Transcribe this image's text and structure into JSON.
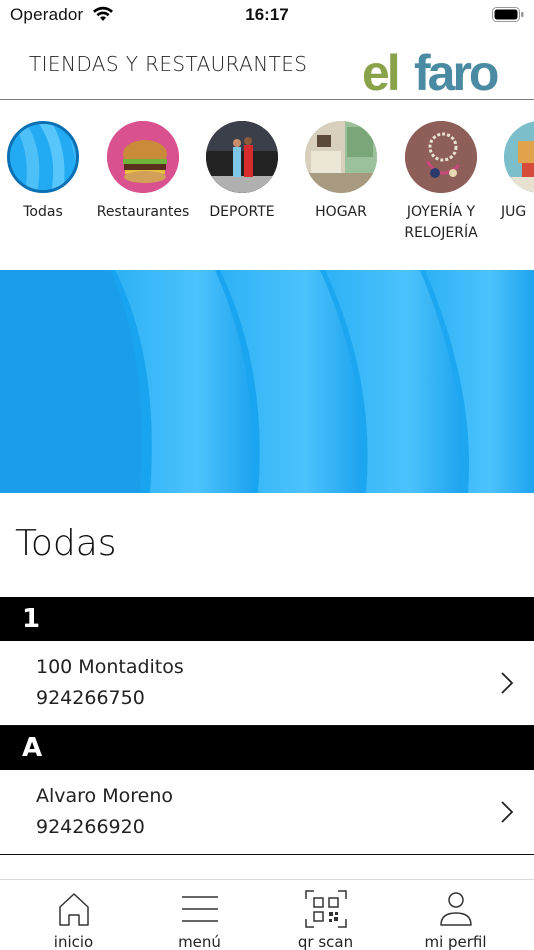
{
  "status_bar": {
    "carrier": "Operador",
    "time": "16:17"
  },
  "header": {
    "title": "TIENDAS Y RESTAURANTES",
    "logo_text": "elfaro"
  },
  "categories": [
    {
      "label": "Todas",
      "icon": "blue-abstract-thumbnail"
    },
    {
      "label": "Restaurantes",
      "icon": "burger-thumbnail"
    },
    {
      "label": "DEPORTE",
      "icon": "sport-people-thumbnail"
    },
    {
      "label": "HOGAR",
      "icon": "living-room-thumbnail"
    },
    {
      "label": "JOYERÍA Y RELOJERÍA",
      "icon": "jewelry-thumbnail"
    },
    {
      "label": "JUG",
      "icon": "toys-thumbnail"
    }
  ],
  "section_title": "Todas",
  "groups": [
    {
      "letter": "1",
      "stores": [
        {
          "name": "100 Montaditos",
          "phone": "924266750"
        }
      ]
    },
    {
      "letter": "A",
      "stores": [
        {
          "name": "Alvaro Moreno",
          "phone": "924266920"
        }
      ]
    }
  ],
  "tabs": [
    {
      "label": "inicio",
      "icon": "home-icon"
    },
    {
      "label": "menú",
      "icon": "menu-icon"
    },
    {
      "label": "qr scan",
      "icon": "qr-scan-icon"
    },
    {
      "label": "mi perfil",
      "icon": "profile-icon"
    }
  ],
  "colors": {
    "accent_blue": "#1aa3f0",
    "logo_green": "#8aa34a",
    "logo_blue": "#4a8ba3",
    "list_header": "#000000"
  }
}
